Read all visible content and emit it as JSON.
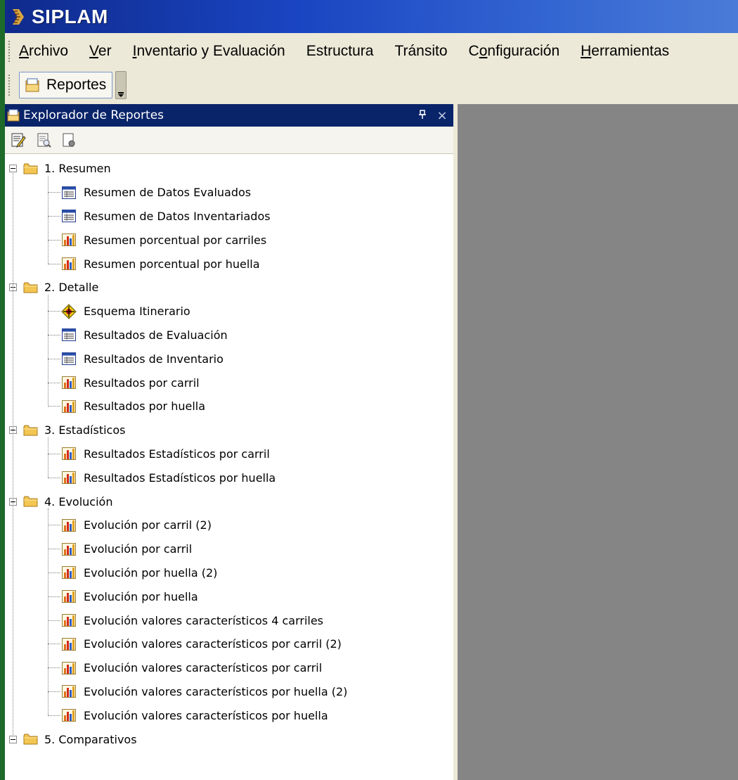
{
  "window": {
    "title": "SIPLAM"
  },
  "menu": [
    {
      "pre": "",
      "u": "A",
      "post": "rchivo"
    },
    {
      "pre": "",
      "u": "V",
      "post": "er"
    },
    {
      "pre": "",
      "u": "I",
      "post": "nventario y Evaluación"
    },
    {
      "pre": "Estructura",
      "u": "",
      "post": ""
    },
    {
      "pre": "Tránsito",
      "u": "",
      "post": ""
    },
    {
      "pre": "C",
      "u": "o",
      "post": "nfiguración"
    },
    {
      "pre": "",
      "u": "H",
      "post": "erramientas"
    }
  ],
  "toolbar": {
    "reportes_label": "Reportes"
  },
  "panel": {
    "title": "Explorador de Reportes",
    "pin_glyph": "ᵩ",
    "close_glyph": "×"
  },
  "tree": [
    {
      "label": "1. Resumen",
      "children": [
        {
          "label": "Resumen de Datos Evaluados",
          "icon": "table-report-icon"
        },
        {
          "label": "Resumen de Datos Inventariados",
          "icon": "table-report-icon"
        },
        {
          "label": "Resumen porcentual por carriles",
          "icon": "chart-report-icon"
        },
        {
          "label": "Resumen porcentual por huella",
          "icon": "chart-report-icon"
        }
      ]
    },
    {
      "label": "2. Detalle",
      "children": [
        {
          "label": "Esquema Itinerario",
          "icon": "diagram-report-icon"
        },
        {
          "label": "Resultados de Evaluación",
          "icon": "table-report-icon"
        },
        {
          "label": "Resultados de Inventario",
          "icon": "table-report-icon"
        },
        {
          "label": "Resultados por carril",
          "icon": "chart-report-icon"
        },
        {
          "label": "Resultados por huella",
          "icon": "chart-report-icon"
        }
      ]
    },
    {
      "label": "3. Estadísticos",
      "children": [
        {
          "label": "Resultados Estadísticos por carril",
          "icon": "chart-report-icon"
        },
        {
          "label": "Resultados Estadísticos por huella",
          "icon": "chart-report-icon"
        }
      ]
    },
    {
      "label": "4. Evolución",
      "children": [
        {
          "label": "Evolución por carril (2)",
          "icon": "chart-report-icon"
        },
        {
          "label": "Evolución por carril",
          "icon": "chart-report-icon"
        },
        {
          "label": "Evolución por huella (2)",
          "icon": "chart-report-icon"
        },
        {
          "label": "Evolución por huella",
          "icon": "chart-report-icon"
        },
        {
          "label": "Evolución valores característicos 4 carriles",
          "icon": "chart-report-icon"
        },
        {
          "label": "Evolución valores característicos por carril (2)",
          "icon": "chart-report-icon"
        },
        {
          "label": "Evolución valores característicos por carril",
          "icon": "chart-report-icon"
        },
        {
          "label": "Evolución valores característicos por huella (2)",
          "icon": "chart-report-icon"
        },
        {
          "label": "Evolución valores característicos por huella",
          "icon": "chart-report-icon"
        }
      ]
    },
    {
      "label": "5. Comparativos",
      "children": []
    }
  ]
}
